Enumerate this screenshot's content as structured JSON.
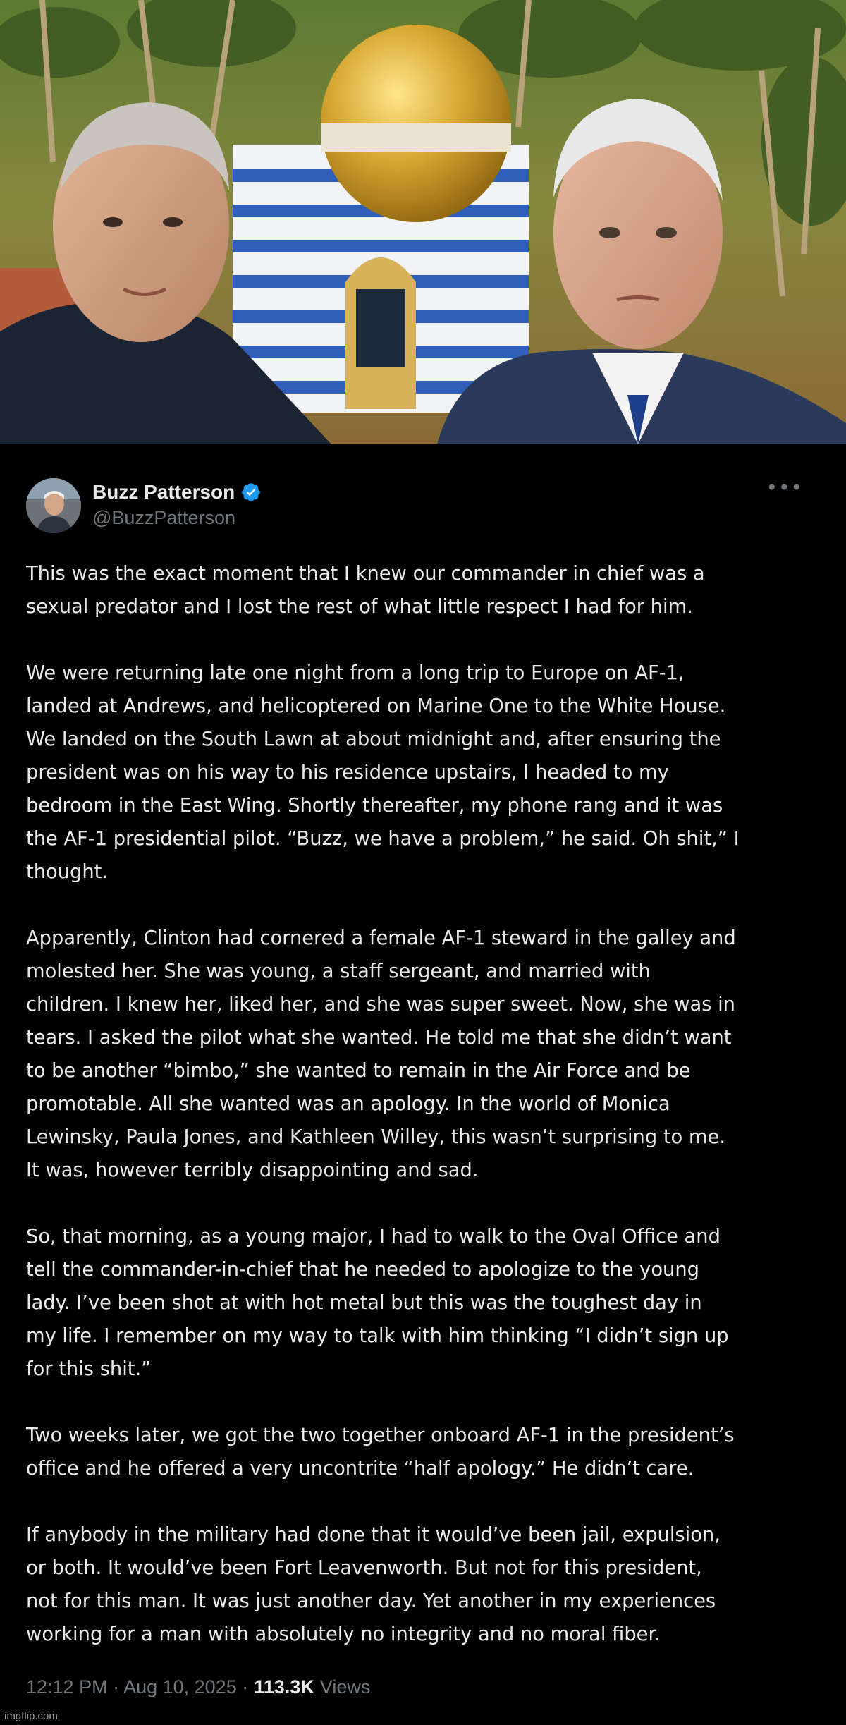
{
  "tweet": {
    "author": {
      "display_name": "Buzz Patterson",
      "handle": "@BuzzPatterson",
      "verified": true
    },
    "more_icon": "more-horizontal-icon",
    "paragraphs": [
      {
        "lines": [
          "This was the exact moment that I knew our commander in chief was a",
          "sexual predator and I lost the rest of what little respect I had for him."
        ]
      },
      {
        "lines": [
          "We were returning late one night from a long trip to Europe on AF-1,",
          "landed at Andrews, and helicoptered on Marine One to the White House.",
          "We landed on the South Lawn at about midnight and, after ensuring the",
          "president was on his way to his residence upstairs, I headed to my",
          "bedroom in the East Wing. Shortly thereafter, my phone rang and it was",
          "the AF-1 presidential pilot. “Buzz, we have a problem,” he said. Oh shit,” I",
          "thought."
        ]
      },
      {
        "lines": [
          "Apparently, Clinton had cornered a female AF-1 steward in the galley and",
          "molested her. She was young, a staff sergeant, and married with",
          "children. I knew her, liked her, and she was super sweet. Now, she was in",
          "tears. I asked the pilot what she wanted. He told me that she didn’t want",
          "to be another “bimbo,” she wanted to remain in the Air Force and be",
          "promotable. All she wanted was an apology. In the world of Monica",
          "Lewinsky, Paula Jones, and Kathleen Willey, this wasn’t surprising to me.",
          "It was, however terribly disappointing and sad."
        ]
      },
      {
        "lines": [
          "So, that morning, as a young major, I had to walk to the Oval Office and",
          "tell the commander-in-chief that he needed to apologize to the young",
          "lady.  I’ve been shot at with hot metal but this was the toughest day in",
          "my life. I remember on my way to talk with him thinking “I didn’t sign up",
          "for this shit.”"
        ]
      },
      {
        "lines": [
          "Two weeks later, we got the two together onboard AF-1 in the president’s",
          "office and he offered a very uncontrite “half apology.” He didn’t care."
        ]
      },
      {
        "lines": [
          "If anybody in the military had done that it would’ve been jail, expulsion,",
          "or both. It would’ve been Fort Leavenworth. But not for this president,",
          "not for this man.  It was just another day. Yet another in my experiences",
          "working for a man with absolutely no integrity and no moral fiber."
        ]
      }
    ],
    "timestamp": "12:12 PM · Aug 10, 2025 ·",
    "views_count": "113.3K",
    "views_label": "Views"
  },
  "watermark": "imgflip.com",
  "colors": {
    "background": "#000000",
    "text_primary": "#e7e9ea",
    "text_secondary": "#71767b",
    "verified_blue": "#1d9bf0"
  }
}
